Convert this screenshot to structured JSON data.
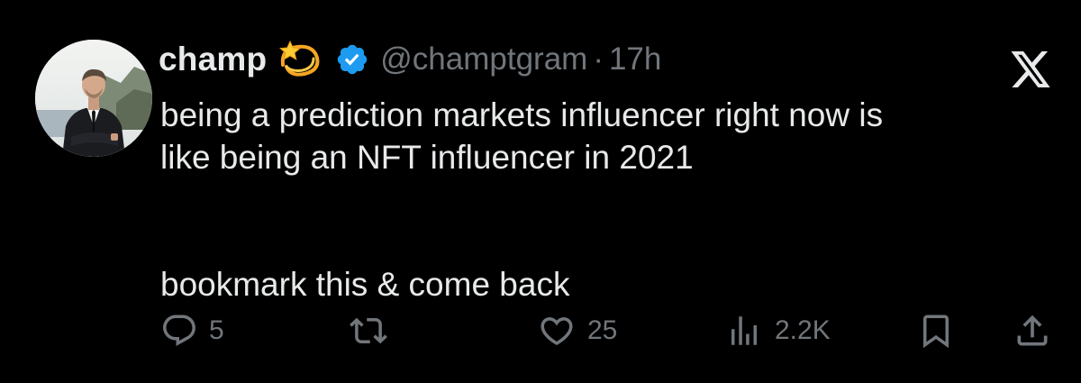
{
  "platform": {
    "logo_icon": "x-logo-icon"
  },
  "author": {
    "display_name": "champ",
    "name_emoji": "dizzy-emoji",
    "verified_icon": "verified-badge-icon",
    "handle": "@champtgram",
    "separator": "·",
    "time_ago": "17h",
    "avatar_icon": "profile-photo"
  },
  "tweet": {
    "lines": [
      "being a prediction markets influencer right now is",
      "like being an NFT influencer in 2021",
      "bookmark this & come back"
    ]
  },
  "actions": {
    "reply": {
      "icon": "reply-icon",
      "count": "5"
    },
    "retweet": {
      "icon": "retweet-icon",
      "count": ""
    },
    "like": {
      "icon": "heart-icon",
      "count": "25"
    },
    "views": {
      "icon": "views-icon",
      "count": "2.2K"
    },
    "bookmark": {
      "icon": "bookmark-icon"
    },
    "share": {
      "icon": "share-icon"
    }
  },
  "colors": {
    "background": "#000000",
    "primary_text": "#e7e9ea",
    "secondary_text": "#71767b",
    "verified_blue": "#1d9bf0"
  }
}
